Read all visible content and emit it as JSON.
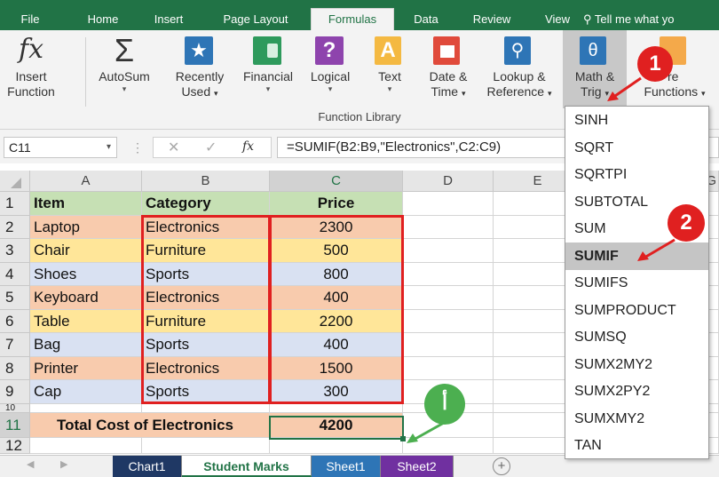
{
  "ribbon": {
    "tabs": [
      "File",
      "Home",
      "Insert",
      "Page Layout",
      "Formulas",
      "Data",
      "Review",
      "View"
    ],
    "active_tab": "Formulas",
    "tell_me": "Tell me what yo",
    "buttons": {
      "insert_function": "Insert",
      "insert_function2": "Function",
      "autosum": "AutoSum",
      "recently_used": "Recently",
      "recently_used2": "Used",
      "financial": "Financial",
      "logical": "Logical",
      "text": "Text",
      "date_time": "Date &",
      "date_time2": "Time",
      "lookup": "Lookup &",
      "lookup2": "Reference",
      "math_trig": "Math &",
      "math_trig2": "Trig",
      "more_functions": "re",
      "more_functions2": "Functions"
    },
    "group_label": "Function Library"
  },
  "formula_bar": {
    "name_box": "C11",
    "fx": "fx",
    "formula": "=SUMIF(B2:B9,\"Electronics\",C2:C9)"
  },
  "grid": {
    "columns": [
      "A",
      "B",
      "C",
      "D",
      "E",
      "G"
    ],
    "rows": [
      "1",
      "2",
      "3",
      "4",
      "5",
      "6",
      "7",
      "8",
      "9",
      "10",
      "11",
      "12"
    ],
    "header_row": [
      "Item",
      "Category",
      "Price"
    ],
    "data": [
      {
        "item": "Laptop",
        "category": "Electronics",
        "price": "2300"
      },
      {
        "item": "Chair",
        "category": "Furniture",
        "price": "500"
      },
      {
        "item": "Shoes",
        "category": "Sports",
        "price": "800"
      },
      {
        "item": "Keyboard",
        "category": "Electronics",
        "price": "400"
      },
      {
        "item": "Table",
        "category": "Furniture",
        "price": "2200"
      },
      {
        "item": "Bag",
        "category": "Sports",
        "price": "400"
      },
      {
        "item": "Printer",
        "category": "Electronics",
        "price": "1500"
      },
      {
        "item": "Cap",
        "category": "Sports",
        "price": "300"
      }
    ],
    "total_label": "Total Cost of Electronics",
    "total_value": "4200"
  },
  "dropdown": {
    "items": [
      "SINH",
      "SQRT",
      "SQRTPI",
      "SUBTOTAL",
      "SUM",
      "SUMIF",
      "SUMIFS",
      "SUMPRODUCT",
      "SUMSQ",
      "SUMX2MY2",
      "SUMX2PY2",
      "SUMXMY2",
      "TAN"
    ],
    "selected": "SUMIF"
  },
  "sheets": {
    "tabs": [
      "Chart1",
      "Student Marks",
      "Sheet1",
      "Sheet2"
    ],
    "active": "Student Marks",
    "add": "+"
  },
  "badges": {
    "one": "1",
    "two": "2",
    "alef": "أ"
  },
  "colors": {
    "excel_green": "#217346",
    "tan_fill": "#f8cbad",
    "yellow_fill": "#ffe699",
    "blue_fill": "#d9e1f2",
    "header_fill": "#c6e0b4",
    "highlight_red": "#e02020",
    "badge_red": "#e02020",
    "badge_green": "#4caf50"
  }
}
